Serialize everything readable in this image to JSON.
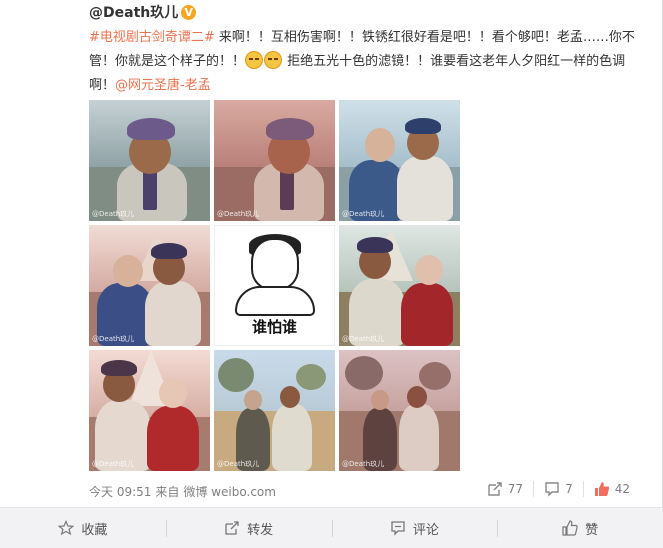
{
  "post": {
    "author": "@Death玖儿",
    "vip_badge": "V",
    "topic": "#电视剧古剑奇谭二#",
    "text_part1": " 来啊！！互相伤害啊！！铁锈红很好看是吧！！看个够吧！老孟……你不管！你就是这个样子的！！",
    "text_part2": " 拒绝五光十色的滤镜！！谁要看这老年人夕阳红一样的色调啊！",
    "mention": "@网元圣唐-老孟",
    "meme_caption": "谁怕谁",
    "watermark": "@Death玖儿"
  },
  "meta": {
    "time": "今天 09:51",
    "source_prefix": "来自",
    "source": "微博 weibo.com"
  },
  "stats": {
    "reposts": "77",
    "comments": "7",
    "likes": "42"
  },
  "actions": {
    "favorite": "收藏",
    "repost": "转发",
    "comment": "评论",
    "like": "赞"
  },
  "colors": {
    "link": "#eb7350",
    "like_icon": "#f26d5f",
    "bar_bg": "#f2f2f5"
  },
  "icons": [
    "verified-badge-icon",
    "emoji-cry-icon",
    "repost-icon",
    "comment-icon",
    "like-icon",
    "star-icon"
  ]
}
